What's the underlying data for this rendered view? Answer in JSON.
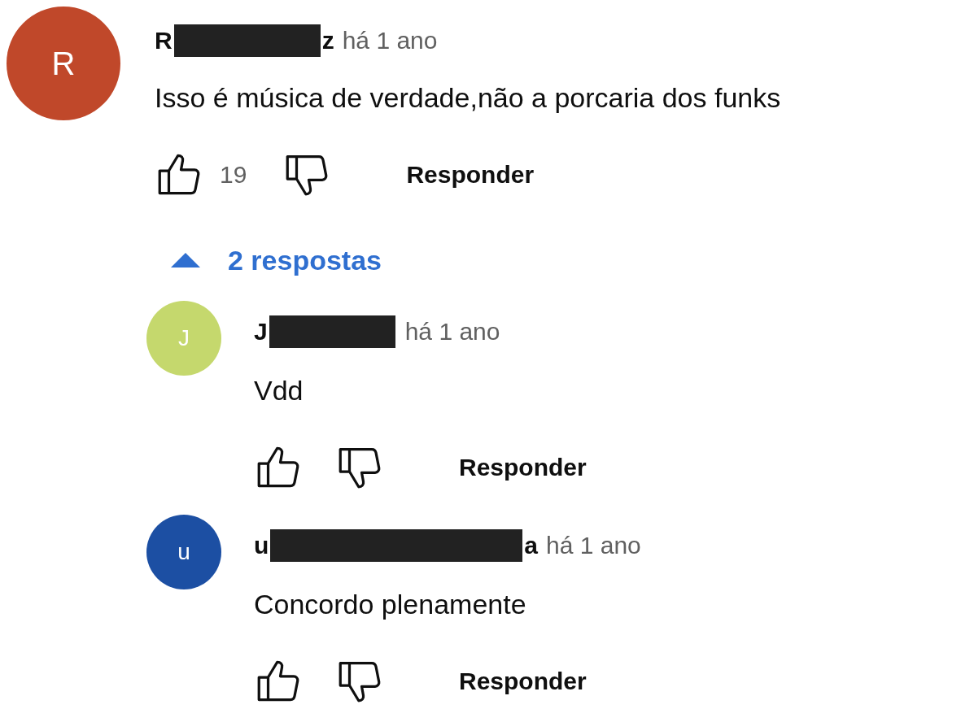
{
  "comment": {
    "avatar": {
      "letter": "R",
      "color": "#c0482a"
    },
    "author": {
      "start": "R",
      "end": "z",
      "redacted": true
    },
    "time": "há 1 ano",
    "text": "Isso é música de verdade,não a porcaria dos funks",
    "likes": "19",
    "reply_label": "Responder"
  },
  "replies_toggle": {
    "label": "2 respostas",
    "expanded": true
  },
  "replies": [
    {
      "avatar": {
        "letter": "J",
        "color": "#c5d86d"
      },
      "author": {
        "start": "J",
        "redacted": true
      },
      "time": "há 1 ano",
      "text": "Vdd",
      "reply_label": "Responder"
    },
    {
      "avatar": {
        "letter": "u",
        "color": "#1c4fa3"
      },
      "author": {
        "start": "u",
        "end": "a",
        "redacted": true
      },
      "time": "há 1 ano",
      "text": "Concordo plenamente",
      "reply_label": "Responder"
    }
  ]
}
